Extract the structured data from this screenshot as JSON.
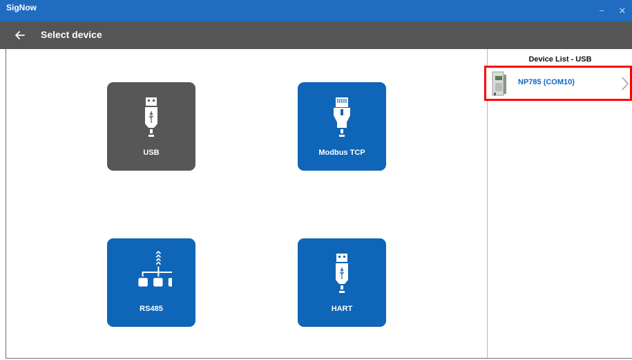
{
  "window": {
    "title": "SigNow",
    "minimize_glyph": "−",
    "close_glyph": "✕"
  },
  "header": {
    "title": "Select device",
    "back_icon": "arrow-left-icon"
  },
  "tiles": [
    {
      "label": "USB",
      "icon": "usb-plug-icon",
      "color": "#575757",
      "selected": true
    },
    {
      "label": "Modbus TCP",
      "icon": "ethernet-plug-icon",
      "color": "#0f65b7",
      "selected": false
    },
    {
      "label": "RS485",
      "icon": "network-tree-icon",
      "color": "#0f65b7",
      "selected": false
    },
    {
      "label": "HART",
      "icon": "usb-plug-icon",
      "color": "#0f65b7",
      "selected": false
    }
  ],
  "device_list": {
    "title": "Device List - USB",
    "items": [
      {
        "name": "NP785 (COM10)",
        "icon": "device-thumbnail-icon",
        "highlighted": true
      }
    ]
  },
  "colors": {
    "titlebar": "#1f6cc0",
    "header": "#555555",
    "tile_active": "#575757",
    "tile_blue": "#0f65b7",
    "highlight": "#ff0000"
  }
}
